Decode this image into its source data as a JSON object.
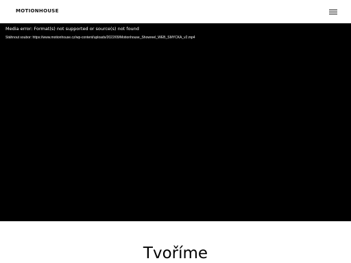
{
  "header": {
    "logo_text": "MOTIONHOUSE",
    "menu_icon": "hamburger-menu-icon"
  },
  "video": {
    "error_text": "Media error: Format(s) not supported or source(s) not found",
    "download_label": "Stáhnout soubor:",
    "download_url": "https://www.motionhouse.cz/wp-content/uploads/2022/09/Motionhouse_Showreel_WEB_SMYCKA_v2.mp4"
  },
  "main": {
    "heading": "Tvoříme"
  }
}
